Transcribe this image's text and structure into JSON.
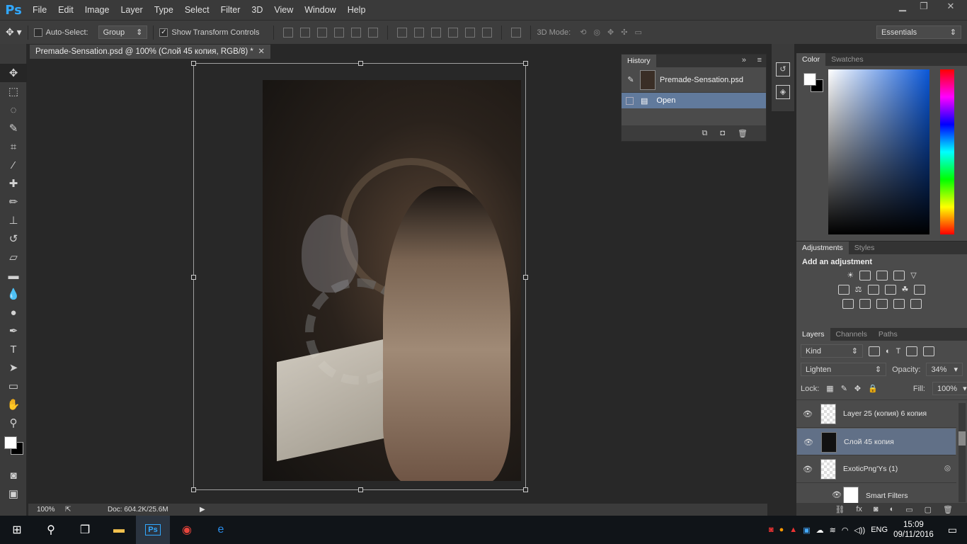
{
  "app": {
    "logo": "Ps"
  },
  "menu": [
    "File",
    "Edit",
    "Image",
    "Layer",
    "Type",
    "Select",
    "Filter",
    "3D",
    "View",
    "Window",
    "Help"
  ],
  "options": {
    "auto_select_label": "Auto-Select:",
    "auto_select_value": "Group",
    "show_transform_label": "Show Transform Controls",
    "mode_3d_label": "3D Mode:",
    "workspace": "Essentials"
  },
  "document": {
    "tab_title": "Premade-Sensation.psd @ 100% (Слой 45 копия, RGB/8) *",
    "zoom": "100%",
    "doc_size": "Doc: 604.2K/25.6M"
  },
  "history": {
    "tab": "History",
    "snapshot": "Premade-Sensation.psd",
    "states": [
      "Open"
    ]
  },
  "color_panel": {
    "tabs": [
      "Color",
      "Swatches"
    ]
  },
  "adjustments": {
    "tabs": [
      "Adjustments",
      "Styles"
    ],
    "heading": "Add an adjustment"
  },
  "layers": {
    "tabs": [
      "Layers",
      "Channels",
      "Paths"
    ],
    "filter_kind": "Kind",
    "blend_mode": "Lighten",
    "opacity_label": "Opacity:",
    "opacity": "34%",
    "lock_label": "Lock:",
    "fill_label": "Fill:",
    "fill": "100%",
    "rows": [
      {
        "name": "Layer 25 (копия) 6 копия"
      },
      {
        "name": "Слой 45 копия"
      },
      {
        "name": "ExoticPng'Ys (1)"
      },
      {
        "name": "Smart Filters"
      }
    ]
  },
  "taskbar": {
    "lang": "ENG",
    "time": "15:09",
    "date": "09/11/2016"
  },
  "colors": {
    "accent": "#31a8ff",
    "selected_layer": "#617087",
    "history_selected": "#617a9c"
  }
}
